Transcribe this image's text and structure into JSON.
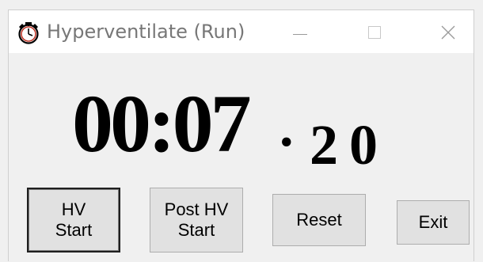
{
  "window": {
    "title": "Hyperventilate (Run)",
    "icon": "stopwatch-icon",
    "controls": {
      "minimize": "minimize-icon",
      "maximize": "maximize-icon",
      "close": "close-icon"
    }
  },
  "timer": {
    "minutes_seconds": "00:07",
    "separator": ".",
    "hundredths": "20"
  },
  "buttons": {
    "hv_start": [
      "HV",
      "Start"
    ],
    "post_hv_start": [
      "Post HV",
      "Start"
    ],
    "reset": "Reset",
    "exit": "Exit"
  },
  "colors": {
    "titlebar_bg": "#ffffff",
    "client_bg": "#f0f0f0",
    "button_bg": "#e1e1e1",
    "title_text": "#777777"
  }
}
